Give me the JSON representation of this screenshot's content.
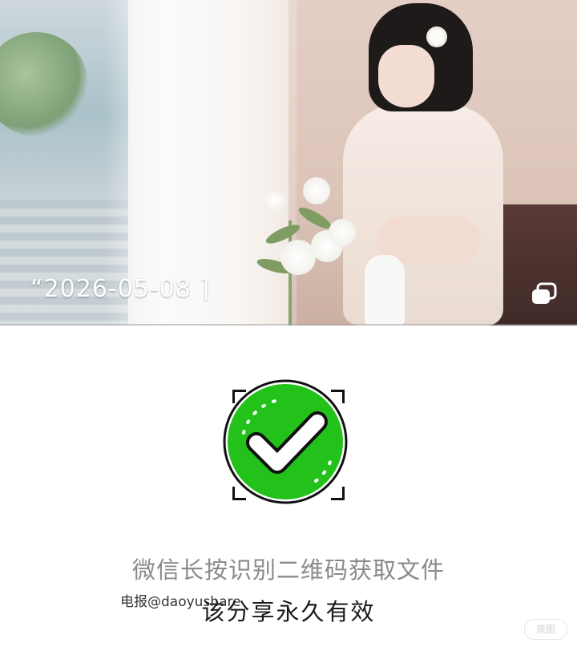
{
  "photo": {
    "date_label": "“2026-05-08 ⌉"
  },
  "qr": {
    "status_icon": "green-check-icon",
    "accent_color": "#22c21a"
  },
  "texts": {
    "instruction": "微信长按识别二维码获取文件",
    "telegram_handle": "电报@daoyushare",
    "validity": "该分享永久有效",
    "watermark": "原图"
  },
  "icons": {
    "copy": "copy-icon"
  }
}
